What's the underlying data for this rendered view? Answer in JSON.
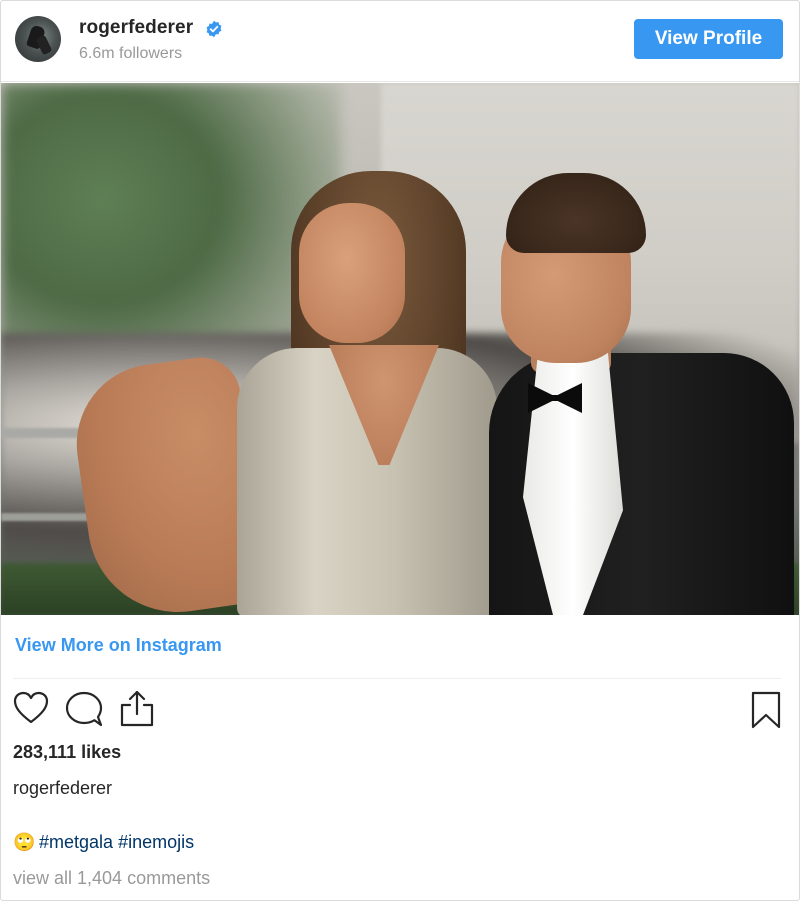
{
  "header": {
    "username": "rogerfederer",
    "followers": "6.6m followers",
    "view_profile_label": "View Profile",
    "verified_icon": "verified-badge-icon",
    "accent": "#3897f0"
  },
  "post": {
    "view_more_label": "View More on Instagram",
    "likes": "283,111 likes",
    "caption_user": "rogerfederer",
    "caption_emoji": "🙄",
    "hashtags": [
      "#metgala",
      "#inemojis"
    ],
    "comments": "view all 1,404 comments"
  },
  "actions": {
    "like_icon": "heart-icon",
    "comment_icon": "comment-icon",
    "share_icon": "share-icon",
    "save_icon": "bookmark-icon"
  }
}
